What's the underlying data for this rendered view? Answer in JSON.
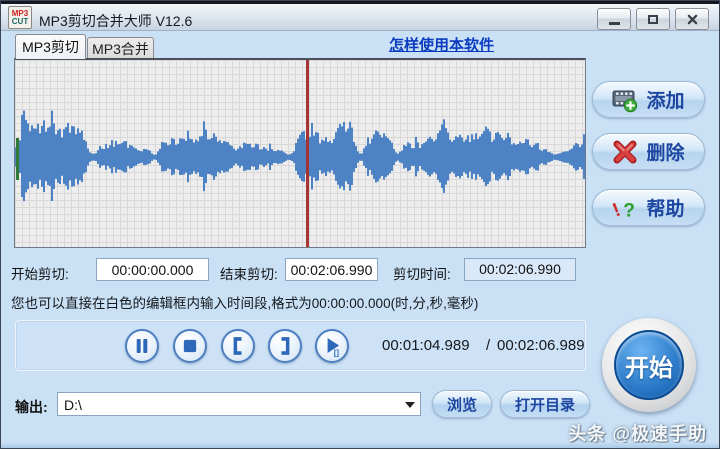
{
  "window": {
    "title": "MP3剪切合并大师 V12.6",
    "icon_top": "MP3",
    "icon_bottom": "CUT"
  },
  "tabs": [
    {
      "label": "MP3剪切",
      "active": true
    },
    {
      "label": "MP3合并",
      "active": false
    }
  ],
  "help_link": "怎样使用本软件",
  "waveform": {
    "cursor_position_pct": 51.0,
    "start_marker_position_pct": 0.2,
    "quiet_zones_pct": [
      13.5,
      24.5,
      48,
      60.5,
      67
    ],
    "colors": {
      "wave": "#4d83c4",
      "cursor_red": "#a63434",
      "marker_green": "#2f7a3a"
    }
  },
  "side_buttons": [
    {
      "label": "添加",
      "icon": "add-media-icon"
    },
    {
      "label": "删除",
      "icon": "delete-icon"
    },
    {
      "label": "帮助",
      "icon": "help-icon"
    }
  ],
  "cut": {
    "start_label": "开始剪切:",
    "start_value": "00:00:00.000",
    "end_label": "结束剪切:",
    "end_value": "00:02:06.990",
    "duration_label": "剪切时间:",
    "duration_value": "00:02:06.990"
  },
  "hint": "您也可以直接在白色的编辑框内输入时间段,格式为00:00:00.000(时,分,秒,毫秒)",
  "playback": {
    "buttons": [
      "pause-icon",
      "stop-icon",
      "bracket-left-icon",
      "bracket-right-icon",
      "play-selection-icon"
    ],
    "position": "00:01:04.989",
    "separator": "/",
    "total": "00:02:06.989"
  },
  "start_button": {
    "label": "开始"
  },
  "output": {
    "label": "输出:",
    "value": "D:\\",
    "browse_label": "浏览",
    "open_dir_label": "打开目录"
  },
  "watermark": "头条 @极速手助",
  "colors": {
    "accent_blue": "#1c46a0",
    "background": "#c9e0f5",
    "link": "#0b3bbf"
  }
}
